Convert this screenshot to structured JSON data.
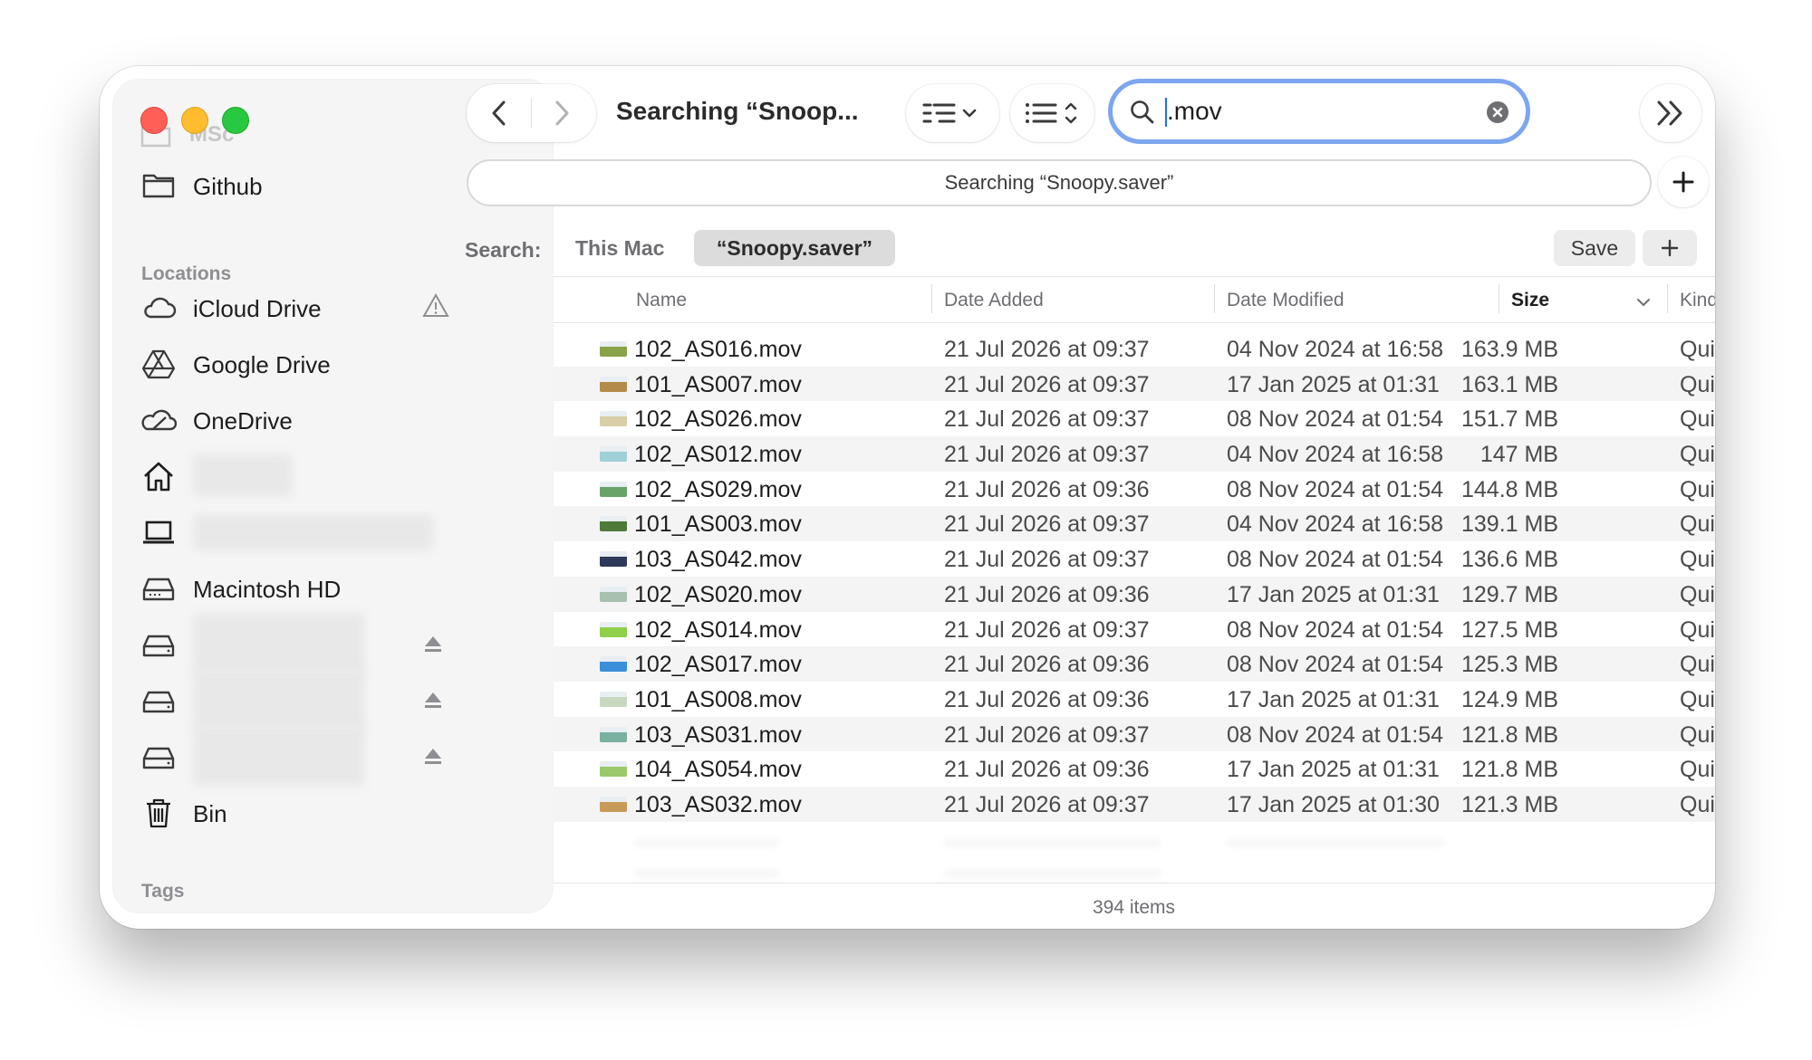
{
  "window": {
    "title": "Searching “Snoop...",
    "path_bar": "Searching “Snoopy.saver”"
  },
  "sidebar": {
    "partial_item": "MSc",
    "top_items": [
      {
        "label": "Github",
        "icon": "folder-icon"
      }
    ],
    "locations_heading": "Locations",
    "locations": [
      {
        "label": "iCloud Drive",
        "icon": "icloud-icon",
        "status": "warning-icon"
      },
      {
        "label": "Google Drive",
        "icon": "google-drive-icon"
      },
      {
        "label": "OneDrive",
        "icon": "onedrive-icon"
      },
      {
        "label": "",
        "icon": "home-icon",
        "redacted": true
      },
      {
        "label": "",
        "icon": "laptop-icon",
        "redacted": true
      },
      {
        "label": "Macintosh HD",
        "icon": "internal-drive-icon"
      },
      {
        "label": "",
        "icon": "external-drive-icon",
        "redacted": true,
        "eject": true
      },
      {
        "label": "",
        "icon": "external-drive-icon",
        "redacted": true,
        "eject": true
      },
      {
        "label": "",
        "icon": "external-drive-icon",
        "redacted": true,
        "eject": true
      },
      {
        "label": "Bin",
        "icon": "trash-icon"
      }
    ],
    "tags_heading": "Tags"
  },
  "search": {
    "query": ".mov",
    "scope_label": "Search:",
    "scope_this_mac": "This Mac",
    "scope_selected": "“Snoopy.saver”",
    "save_label": "Save"
  },
  "table": {
    "columns": [
      "Name",
      "Date Added",
      "Date Modified",
      "Size",
      "Kind"
    ],
    "sorted_column": "Size",
    "rows": [
      {
        "name": "102_AS016.mov",
        "added": "21 Jul 2026 at 09:37",
        "modified": "04 Nov 2024 at 16:58",
        "size": "163.9 MB",
        "kind": "QuickTime movie",
        "thumb": "#8aa34a"
      },
      {
        "name": "101_AS007.mov",
        "added": "21 Jul 2026 at 09:37",
        "modified": "17 Jan 2025 at 01:31",
        "size": "163.1 MB",
        "kind": "QuickTime movie",
        "thumb": "#b38a4a"
      },
      {
        "name": "102_AS026.mov",
        "added": "21 Jul 2026 at 09:37",
        "modified": "08 Nov 2024 at 01:54",
        "size": "151.7 MB",
        "kind": "QuickTime movie",
        "thumb": "#d8cfa8"
      },
      {
        "name": "102_AS012.mov",
        "added": "21 Jul 2026 at 09:37",
        "modified": "04 Nov 2024 at 16:58",
        "size": "147 MB",
        "kind": "QuickTime movie",
        "thumb": "#9fd0d8"
      },
      {
        "name": "102_AS029.mov",
        "added": "21 Jul 2026 at 09:36",
        "modified": "08 Nov 2024 at 01:54",
        "size": "144.8 MB",
        "kind": "QuickTime movie",
        "thumb": "#6aa36a"
      },
      {
        "name": "101_AS003.mov",
        "added": "21 Jul 2026 at 09:37",
        "modified": "04 Nov 2024 at 16:58",
        "size": "139.1 MB",
        "kind": "QuickTime movie",
        "thumb": "#4f7a3a"
      },
      {
        "name": "103_AS042.mov",
        "added": "21 Jul 2026 at 09:37",
        "modified": "08 Nov 2024 at 01:54",
        "size": "136.6 MB",
        "kind": "QuickTime movie",
        "thumb": "#2f3a5a"
      },
      {
        "name": "102_AS020.mov",
        "added": "21 Jul 2026 at 09:36",
        "modified": "17 Jan 2025 at 01:31",
        "size": "129.7 MB",
        "kind": "QuickTime movie",
        "thumb": "#a8c0b0"
      },
      {
        "name": "102_AS014.mov",
        "added": "21 Jul 2026 at 09:37",
        "modified": "08 Nov 2024 at 01:54",
        "size": "127.5 MB",
        "kind": "QuickTime movie",
        "thumb": "#8fcf4a"
      },
      {
        "name": "102_AS017.mov",
        "added": "21 Jul 2026 at 09:36",
        "modified": "08 Nov 2024 at 01:54",
        "size": "125.3 MB",
        "kind": "QuickTime movie",
        "thumb": "#3a8fd8"
      },
      {
        "name": "101_AS008.mov",
        "added": "21 Jul 2026 at 09:36",
        "modified": "17 Jan 2025 at 01:31",
        "size": "124.9 MB",
        "kind": "QuickTime movie",
        "thumb": "#c8d8c0"
      },
      {
        "name": "103_AS031.mov",
        "added": "21 Jul 2026 at 09:37",
        "modified": "08 Nov 2024 at 01:54",
        "size": "121.8 MB",
        "kind": "QuickTime movie",
        "thumb": "#7ab0a0"
      },
      {
        "name": "104_AS054.mov",
        "added": "21 Jul 2026 at 09:36",
        "modified": "17 Jan 2025 at 01:31",
        "size": "121.8 MB",
        "kind": "QuickTime movie",
        "thumb": "#9ac86a"
      },
      {
        "name": "103_AS032.mov",
        "added": "21 Jul 2026 at 09:37",
        "modified": "17 Jan 2025 at 01:30",
        "size": "121.3 MB",
        "kind": "QuickTime movie",
        "thumb": "#c89a5a"
      }
    ]
  },
  "status": {
    "item_count": "394 items"
  }
}
